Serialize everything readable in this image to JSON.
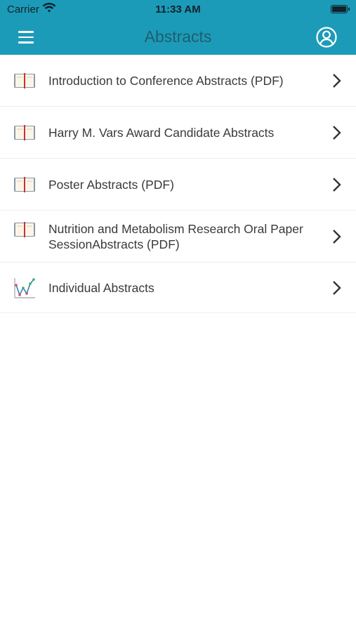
{
  "status_bar": {
    "carrier": "Carrier",
    "time": "11:33 AM"
  },
  "header": {
    "title": "Abstracts",
    "background": "#1c9bb8",
    "title_color": "#1e5f6e"
  },
  "list": {
    "items": [
      {
        "label": "Introduction to Conference Abstracts (PDF)",
        "icon": "book-icon"
      },
      {
        "label": "Harry M. Vars Award Candidate Abstracts",
        "icon": "book-icon"
      },
      {
        "label": "Poster Abstracts (PDF)",
        "icon": "book-icon"
      },
      {
        "label": "Nutrition and Metabolism Research Oral Paper SessionAbstracts (PDF)",
        "icon": "book-icon"
      },
      {
        "label": "Individual Abstracts",
        "icon": "chart-icon"
      }
    ]
  }
}
